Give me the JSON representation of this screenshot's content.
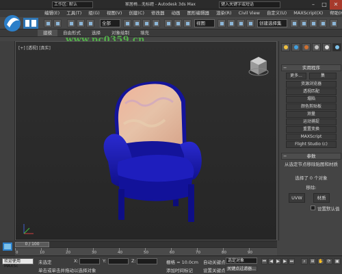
{
  "titlebar": {
    "workspace": "工作区: 默认",
    "doc_title": "家居椅…无标题 - Autodesk 3ds Max",
    "search_placeholder": "键入关键字或短语"
  },
  "menu": [
    "编辑(E)",
    "工具(T)",
    "组(G)",
    "视图(V)",
    "创建(C)",
    "修改器",
    "动画",
    "图形编辑器",
    "渲染(R)",
    "Civil View",
    "自定义(U)",
    "MAXScript(X)",
    "帮助(H)"
  ],
  "toolbar": {
    "filter_select": "全部",
    "view_select": "视图",
    "selection_set": "创建选择集"
  },
  "ribbon_tabs": [
    "建模",
    "自由形式",
    "选择",
    "对象绘制",
    "填充"
  ],
  "watermark": "www.pc0359.cn",
  "viewport": {
    "label": "[+] [透视] [真实]"
  },
  "command_panel": {
    "utilities_title": "实用程序",
    "more": "更多...",
    "sets": "集",
    "buttons": [
      "资源浏览器",
      "透视匹配",
      "塌陷",
      "颜色剪贴板",
      "测量",
      "运动捕捉",
      "重置变换",
      "MAXScript",
      "Flight Studio (c)"
    ],
    "params_title": "参数",
    "params_desc": "从选定节点移除贴图和材质",
    "selected_count": "选择了 0 个对象",
    "remove_label": "移除:",
    "uvw": "UVW",
    "material": "材质",
    "set_checkbox": "设置默认值"
  },
  "timeline": {
    "frame": "0 / 100",
    "ticks": [
      "0",
      "10",
      "20",
      "30",
      "40",
      "50",
      "60",
      "70",
      "80",
      "90"
    ]
  },
  "status": {
    "welcome": "欢迎使用 MAXSc",
    "none_selected": "未选定",
    "prompt": "单击或单击并拖动以选择对象",
    "x_label": "X:",
    "y_label": "Y:",
    "z_label": "Z:",
    "grid": "栅格 = 10.0cm",
    "add_time_tag": "添加时间标记",
    "auto_key": "自动关键点",
    "selected_obj": "选定对象",
    "set_key": "设置关键点",
    "key_filter": "关键点过滤器..."
  },
  "colors": {
    "chair_seat": "#1a1aa8",
    "chair_back": "#e8a888",
    "accent_blue": "#2c7fc9",
    "key_red": "#b92b1f"
  }
}
